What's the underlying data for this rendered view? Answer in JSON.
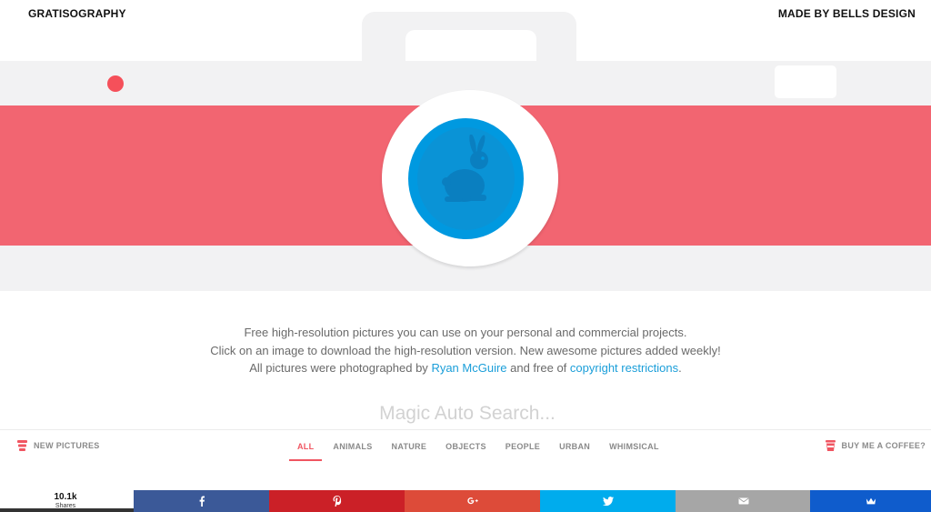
{
  "header": {
    "brand": "GRATISOGRAPHY",
    "made_by": "MADE BY BELLS DESIGN"
  },
  "intro": {
    "line1": "Free high-resolution pictures you can use on your personal and commercial projects.",
    "line2": "Click on an image to download the high-resolution version. New awesome pictures added weekly!",
    "line3_before": "All pictures were photographed by ",
    "line3_link1": "Ryan McGuire",
    "line3_mid": " and free of ",
    "line3_link2": "copyright restrictions",
    "line3_after": "."
  },
  "search": {
    "placeholder": "Magic Auto Search..."
  },
  "nav": {
    "new_pictures": "NEW PICTURES",
    "coffee": "BUY ME A COFFEE?",
    "tabs": [
      {
        "label": "ALL",
        "active": true
      },
      {
        "label": "ANIMALS",
        "active": false
      },
      {
        "label": "NATURE",
        "active": false
      },
      {
        "label": "OBJECTS",
        "active": false
      },
      {
        "label": "PEOPLE",
        "active": false
      },
      {
        "label": "URBAN",
        "active": false
      },
      {
        "label": "WHIMSICAL",
        "active": false
      }
    ]
  },
  "share": {
    "count": "10.1k",
    "label": "Shares",
    "buttons": [
      {
        "name": "facebook",
        "icon": "facebook-icon",
        "color": "#3b5998"
      },
      {
        "name": "pinterest",
        "icon": "pinterest-icon",
        "color": "#cb2027"
      },
      {
        "name": "google-plus",
        "icon": "google-plus-icon",
        "color": "#dd4b39"
      },
      {
        "name": "twitter",
        "icon": "twitter-icon",
        "color": "#00aced"
      },
      {
        "name": "email",
        "icon": "email-icon",
        "color": "#a6a6a6"
      },
      {
        "name": "sumome",
        "icon": "crown-icon",
        "color": "#0f5ccc"
      }
    ]
  },
  "colors": {
    "accent": "#f05561",
    "camera_stripe": "#f26571",
    "lens_blue": "#0099e0",
    "link": "#1a9ed9"
  }
}
